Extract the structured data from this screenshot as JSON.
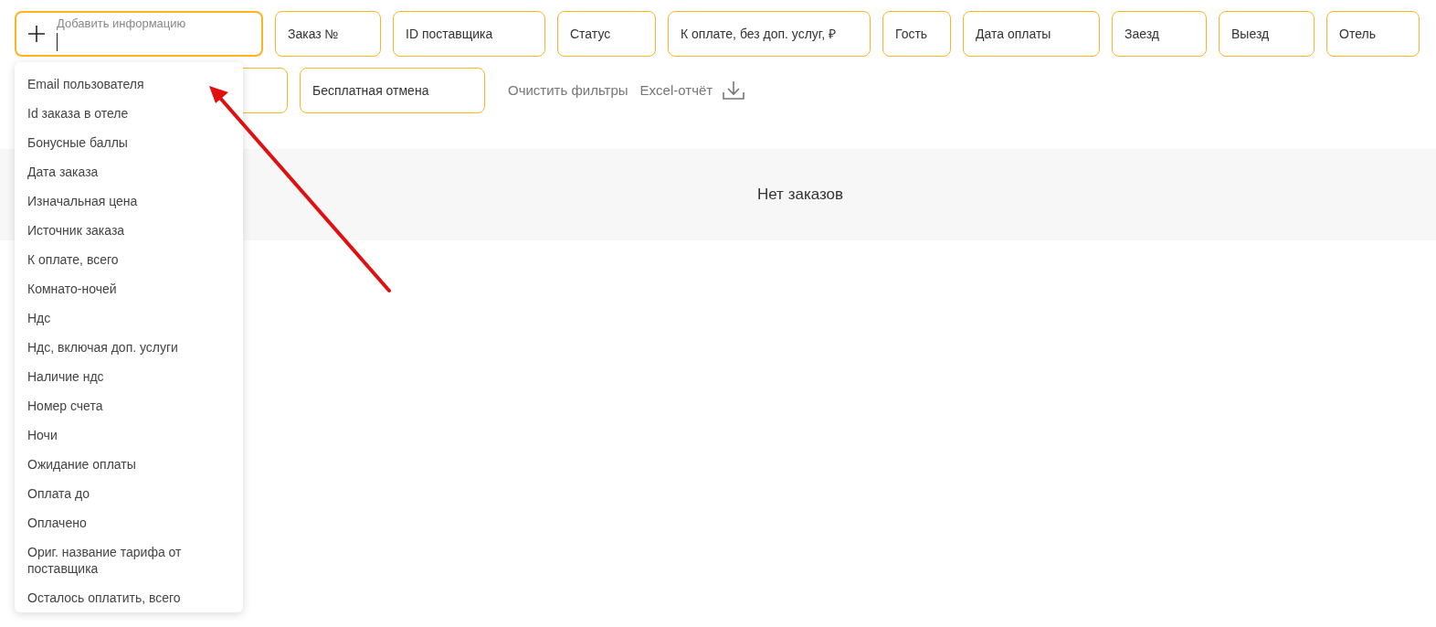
{
  "add_field": {
    "placeholder": "Добавить информацию"
  },
  "filters": [
    {
      "label": "Заказ №"
    },
    {
      "label": "ID поставщика"
    },
    {
      "label": "Статус"
    },
    {
      "label": "К оплате, без доп. услуг, ₽"
    },
    {
      "label": "Гость"
    },
    {
      "label": "Дата оплаты"
    },
    {
      "label": "Заезд"
    },
    {
      "label": "Выезд"
    },
    {
      "label": "Отель"
    },
    {
      "label": "Бесплатная отмена"
    }
  ],
  "clear_filters": "Очистить фильтры",
  "excel_report": "Excel-отчёт",
  "empty_message": "Нет заказов",
  "dropdown_items": [
    "Email пользователя",
    "Id заказа в отеле",
    "Бонусные баллы",
    "Дата заказа",
    "Изначальная цена",
    "Источник заказа",
    "К оплате, всего",
    "Комнато-ночей",
    "Ндс",
    "Ндс, включая доп. услуги",
    "Наличие ндс",
    "Номер счета",
    "Ночи",
    "Ожидание оплаты",
    "Оплата до",
    "Оплачено",
    "Ориг. название тарифа от поставщика",
    "Осталось оплатить, всего"
  ]
}
